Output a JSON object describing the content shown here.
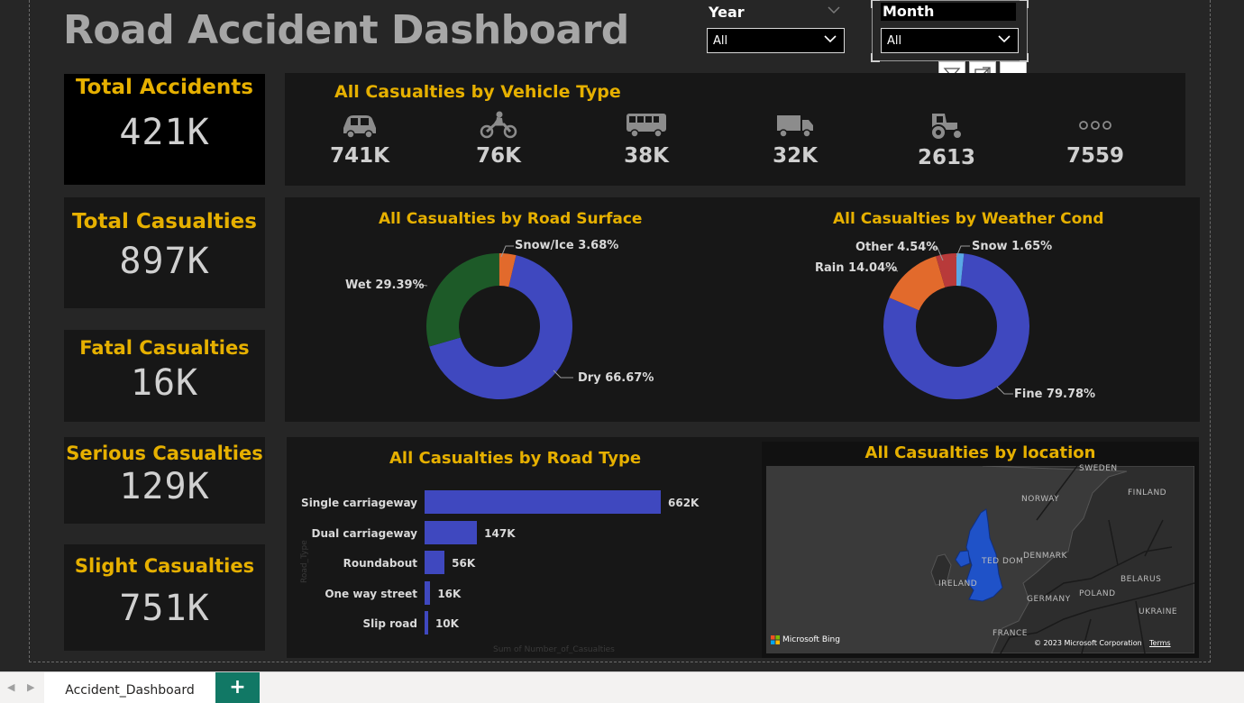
{
  "title": "Road Accident Dashboard",
  "slicers": {
    "year": {
      "label": "Year",
      "value": "All"
    },
    "month": {
      "label": "Month",
      "value": "All"
    }
  },
  "kpis": [
    {
      "label": "Total Accidents",
      "value": "421K"
    },
    {
      "label": "Total Casualties",
      "value": "897K"
    },
    {
      "label": "Fatal Casualties",
      "value": "16K"
    },
    {
      "label": "Serious Casualties",
      "value": "129K"
    },
    {
      "label": "Slight Casualties",
      "value": "751K"
    }
  ],
  "vehicle_panel": {
    "title": "All Casualties by Vehicle Type",
    "items": [
      {
        "icon": "car-icon",
        "value": "741K"
      },
      {
        "icon": "motorcycle-icon",
        "value": "76K"
      },
      {
        "icon": "bus-icon",
        "value": "38K"
      },
      {
        "icon": "truck-icon",
        "value": "32K"
      },
      {
        "icon": "tractor-icon",
        "value": "2613"
      },
      {
        "icon": "more-icon",
        "value": "7559"
      }
    ]
  },
  "road_surface": {
    "title": "All Casualties by Road Surface",
    "labels": {
      "snow": "Snow/Ice 3.68%",
      "wet": "Wet 29.39%",
      "dry": "Dry 66.67%"
    }
  },
  "weather": {
    "title": "All Casualties by Weather Cond",
    "labels": {
      "other": "Other 4.54%",
      "snow": "Snow 1.65%",
      "rain": "Rain 14.04%",
      "fine": "Fine 79.78%"
    }
  },
  "road_type": {
    "title": "All Casualties by Road Type",
    "y_axis_title": "Road_Type",
    "x_axis_title": "Sum of Number_of_Casualties"
  },
  "map": {
    "title": "All Casualties by location",
    "countries": [
      "SWEDEN",
      "FINLAND",
      "NORWAY",
      "DENMARK",
      "IRELAND",
      "GERMANY",
      "POLAND",
      "BELARUS",
      "UKRAINE",
      "FRANCE"
    ],
    "uk_label": "TED DOM",
    "bing": "Microsoft Bing",
    "copyright": "© 2023 Microsoft Corporation",
    "terms": "Terms"
  },
  "tabs": {
    "active": "Accident_Dashboard",
    "add": "+"
  },
  "colors": {
    "accent": "#e6b000",
    "blue": "#3f48bf",
    "green": "#1d5a28",
    "orange": "#e26a2c",
    "red": "#b83a3a",
    "lightblue": "#5aa8e6"
  },
  "chart_data": [
    {
      "type": "pie",
      "title": "All Casualties by Road Surface",
      "categories": [
        "Dry",
        "Wet",
        "Snow/Ice"
      ],
      "values": [
        66.67,
        29.39,
        3.68
      ]
    },
    {
      "type": "pie",
      "title": "All Casualties by Weather Cond",
      "categories": [
        "Fine",
        "Rain",
        "Other",
        "Snow"
      ],
      "values": [
        79.78,
        14.04,
        4.54,
        1.65
      ]
    },
    {
      "type": "bar",
      "title": "All Casualties by Road Type",
      "categories": [
        "Single carriageway",
        "Dual carriageway",
        "Roundabout",
        "One way street",
        "Slip road"
      ],
      "values": [
        662,
        147,
        56,
        16,
        10
      ],
      "value_labels": [
        "662K",
        "147K",
        "56K",
        "16K",
        "10K"
      ],
      "xlabel": "Sum of Number_of_Casualties",
      "ylabel": "Road_Type"
    }
  ]
}
